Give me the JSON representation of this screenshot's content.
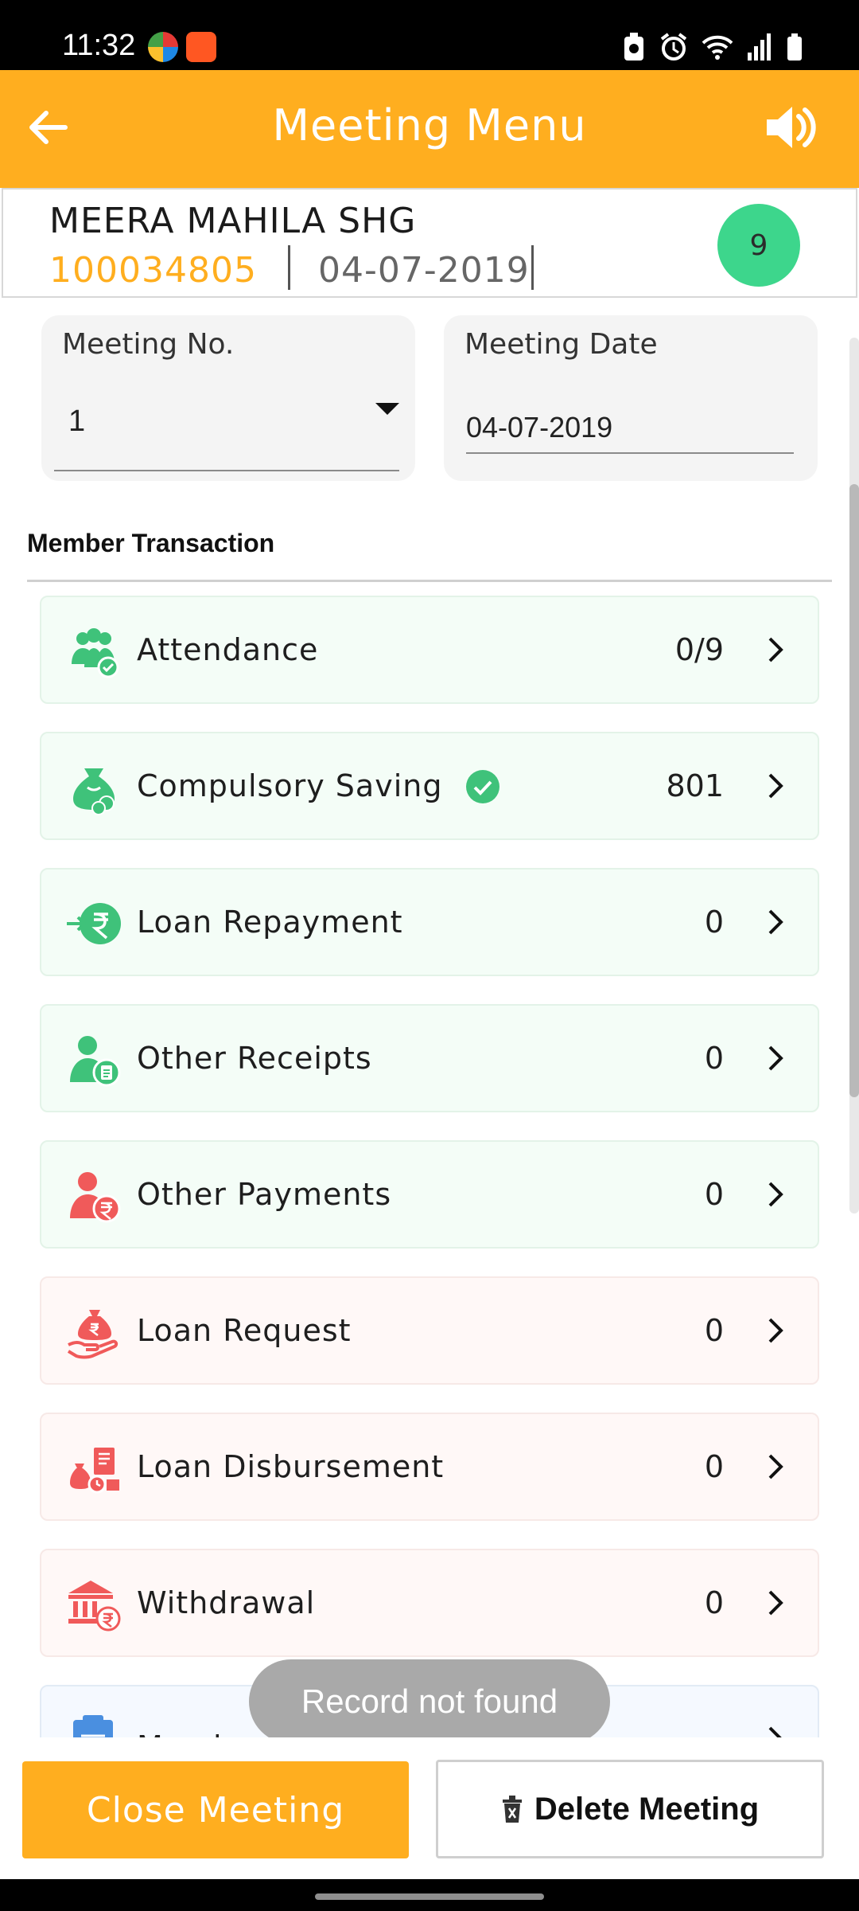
{
  "status_bar": {
    "time": "11:32"
  },
  "app_bar": {
    "title": "Meeting Menu",
    "back_icon": "arrow-left-icon",
    "speaker_icon": "speaker-icon"
  },
  "group": {
    "name": "MEERA MAHILA SHG",
    "code": "100034805",
    "date": "04-07-2019",
    "member_count": "9"
  },
  "meeting": {
    "number_label": "Meeting No.",
    "number_value": "1",
    "date_label": "Meeting Date",
    "date_value": "04-07-2019"
  },
  "section": {
    "title": "Member Transaction"
  },
  "transactions": [
    {
      "label": "Attendance",
      "value": "0/9",
      "icon": "attendance-icon",
      "tone": "green"
    },
    {
      "label": "Compulsory Saving",
      "value": "801",
      "icon": "saving-icon",
      "tone": "green",
      "checked": true
    },
    {
      "label": "Loan Repayment",
      "value": "0",
      "icon": "rupee-in-icon",
      "tone": "green"
    },
    {
      "label": "Other Receipts",
      "value": "0",
      "icon": "receipt-icon",
      "tone": "green"
    },
    {
      "label": "Other Payments",
      "value": "0",
      "icon": "payment-icon",
      "tone": "green"
    },
    {
      "label": "Loan Request",
      "value": "0",
      "icon": "loan-request-icon",
      "tone": "red"
    },
    {
      "label": "Loan Disbursement",
      "value": "0",
      "icon": "disbursement-icon",
      "tone": "red"
    },
    {
      "label": "Withdrawal",
      "value": "0",
      "icon": "bank-icon",
      "tone": "red"
    },
    {
      "label": "Member Summary",
      "value": "",
      "icon": "clipboard-icon",
      "tone": "blue"
    }
  ],
  "toast": {
    "text": "Record not found"
  },
  "actions": {
    "close_label": "Close Meeting",
    "delete_label": "Delete Meeting"
  },
  "colors": {
    "accent": "#ffae1f",
    "badge": "#3dd68c",
    "green": "#3fc27a",
    "red": "#f05a5a"
  }
}
